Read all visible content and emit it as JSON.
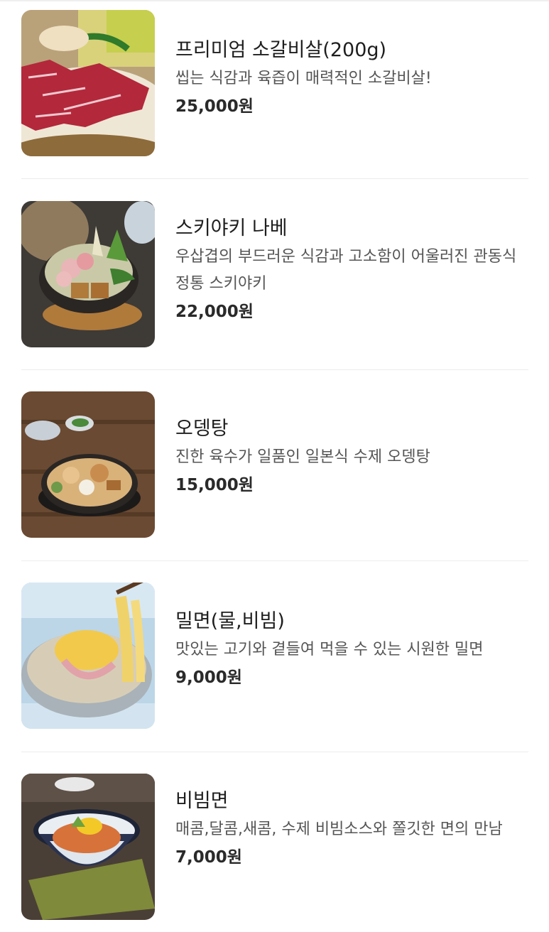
{
  "menu": {
    "items": [
      {
        "name": "프리미엄 소갈비살(200g)",
        "description": "씹는 식감과 육즙이 매력적인 소갈비살!",
        "price": "25,000원",
        "image": "beef-short-rib-photo"
      },
      {
        "name": "스키야키 나베",
        "description": "우삽겹의 부드러운 식감과 고소함이 어울러진 관동식 정통 스키야키",
        "price": "22,000원",
        "image": "sukiyaki-hotpot-photo"
      },
      {
        "name": "오뎅탕",
        "description": "진한 육수가 일품인 일본식 수제 오뎅탕",
        "price": "15,000원",
        "image": "oden-soup-photo"
      },
      {
        "name": "밀면(물,비빔)",
        "description": "맛있는 고기와 곁들여 먹을 수 있는 시원한 밀면",
        "price": "9,000원",
        "image": "cold-noodle-photo"
      },
      {
        "name": "비빔면",
        "description": "매콤,달콤,새콤, 수제 비빔소스와 쫄깃한 면의 만남",
        "price": "7,000원",
        "image": "spicy-noodle-photo"
      }
    ]
  }
}
